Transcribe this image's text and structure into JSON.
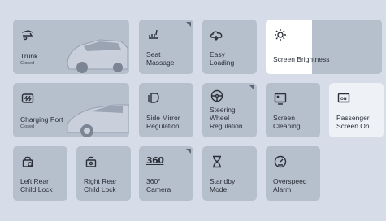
{
  "tiles": {
    "trunk": {
      "label": "Trunk",
      "status": "Closed"
    },
    "seat_massage": {
      "label": "Seat\nMassage"
    },
    "easy_loading": {
      "label": "Easy\nLoading"
    },
    "screen_brightness": {
      "label": "Screen Brightness",
      "level": 0.4
    },
    "charging_port": {
      "label": "Charging Port",
      "status": "Closed"
    },
    "side_mirror": {
      "label": "Side Mirror\nRegulation"
    },
    "steering_wheel": {
      "label": "Steering\nWheel\nRegulation"
    },
    "screen_cleaning": {
      "label": "Screen\nCleaning"
    },
    "passenger_screen": {
      "label": "Passenger\nScreen On",
      "icon_text": "ON"
    },
    "left_rear_lock": {
      "label": "Left Rear\nChild Lock"
    },
    "right_rear_lock": {
      "label": "Right Rear\nChild Lock"
    },
    "camera_360": {
      "label": "360°\nCamera",
      "icon_text": "360"
    },
    "standby": {
      "label": "Standby\nMode"
    },
    "overspeed": {
      "label": "Overspeed\nAlarm"
    }
  },
  "colors": {
    "background": "#d6dde8",
    "tile": "#b6bfcc",
    "tile_active": "#eef1f6"
  }
}
